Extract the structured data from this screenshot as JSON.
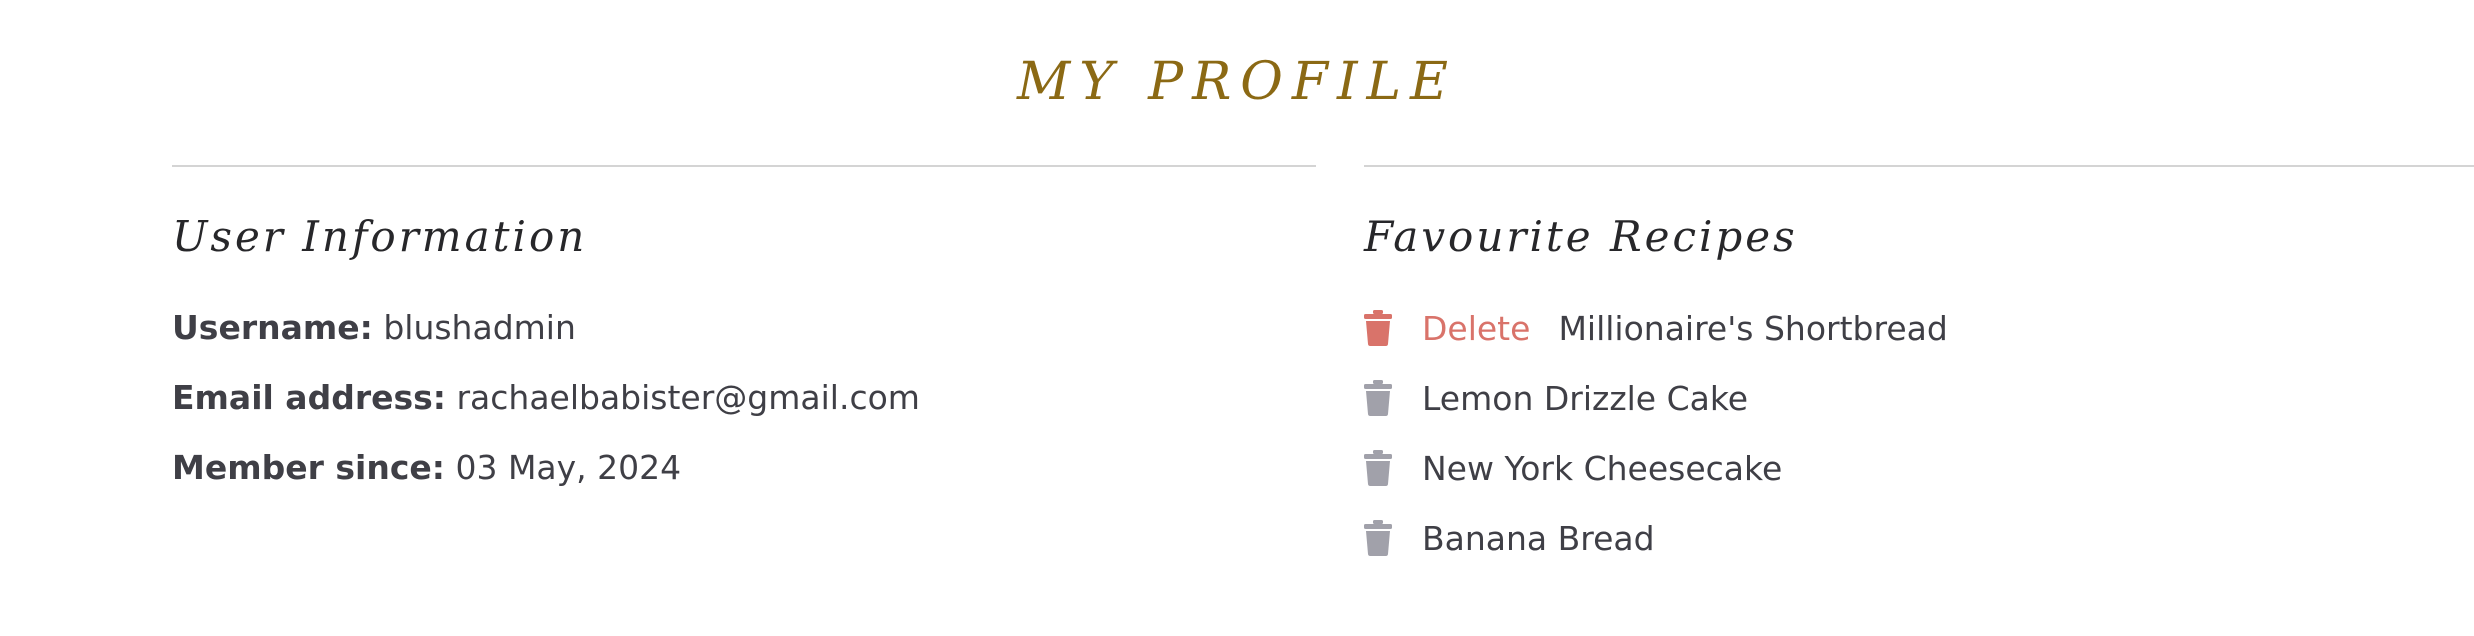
{
  "page": {
    "title": "MY PROFILE"
  },
  "user_info": {
    "heading": "User Information",
    "rows": [
      {
        "label": "Username:",
        "value": "blushadmin"
      },
      {
        "label": "Email address:",
        "value": "rachaelbabister@gmail.com"
      },
      {
        "label": "Member since:",
        "value": "03 May, 2024"
      }
    ]
  },
  "favourites": {
    "heading": "Favourite Recipes",
    "delete_label": "Delete",
    "items": [
      {
        "name": "Millionaire's Shortbread",
        "icon": "trash-icon",
        "hovered": true
      },
      {
        "name": "Lemon Drizzle Cake",
        "icon": "trash-icon",
        "hovered": false
      },
      {
        "name": "New York Cheesecake",
        "icon": "trash-icon",
        "hovered": false
      },
      {
        "name": "Banana Bread",
        "icon": "trash-icon",
        "hovered": false
      }
    ]
  },
  "colors": {
    "title": "#8b6914",
    "delete_active": "#d9736a",
    "icon_idle": "#a1a1aa",
    "text": "#3f3f46",
    "divider": "#d4d4d4"
  }
}
